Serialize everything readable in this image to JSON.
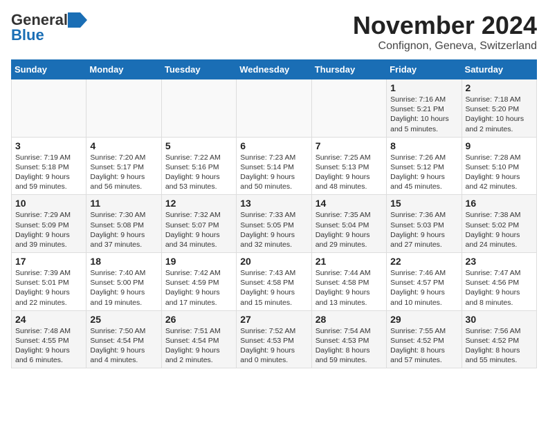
{
  "header": {
    "logo_line1": "General",
    "logo_line2": "Blue",
    "title": "November 2024",
    "subtitle": "Confignon, Geneva, Switzerland"
  },
  "weekdays": [
    "Sunday",
    "Monday",
    "Tuesday",
    "Wednesday",
    "Thursday",
    "Friday",
    "Saturday"
  ],
  "weeks": [
    [
      {
        "day": "",
        "detail": ""
      },
      {
        "day": "",
        "detail": ""
      },
      {
        "day": "",
        "detail": ""
      },
      {
        "day": "",
        "detail": ""
      },
      {
        "day": "",
        "detail": ""
      },
      {
        "day": "1",
        "detail": "Sunrise: 7:16 AM\nSunset: 5:21 PM\nDaylight: 10 hours\nand 5 minutes."
      },
      {
        "day": "2",
        "detail": "Sunrise: 7:18 AM\nSunset: 5:20 PM\nDaylight: 10 hours\nand 2 minutes."
      }
    ],
    [
      {
        "day": "3",
        "detail": "Sunrise: 7:19 AM\nSunset: 5:18 PM\nDaylight: 9 hours\nand 59 minutes."
      },
      {
        "day": "4",
        "detail": "Sunrise: 7:20 AM\nSunset: 5:17 PM\nDaylight: 9 hours\nand 56 minutes."
      },
      {
        "day": "5",
        "detail": "Sunrise: 7:22 AM\nSunset: 5:16 PM\nDaylight: 9 hours\nand 53 minutes."
      },
      {
        "day": "6",
        "detail": "Sunrise: 7:23 AM\nSunset: 5:14 PM\nDaylight: 9 hours\nand 50 minutes."
      },
      {
        "day": "7",
        "detail": "Sunrise: 7:25 AM\nSunset: 5:13 PM\nDaylight: 9 hours\nand 48 minutes."
      },
      {
        "day": "8",
        "detail": "Sunrise: 7:26 AM\nSunset: 5:12 PM\nDaylight: 9 hours\nand 45 minutes."
      },
      {
        "day": "9",
        "detail": "Sunrise: 7:28 AM\nSunset: 5:10 PM\nDaylight: 9 hours\nand 42 minutes."
      }
    ],
    [
      {
        "day": "10",
        "detail": "Sunrise: 7:29 AM\nSunset: 5:09 PM\nDaylight: 9 hours\nand 39 minutes."
      },
      {
        "day": "11",
        "detail": "Sunrise: 7:30 AM\nSunset: 5:08 PM\nDaylight: 9 hours\nand 37 minutes."
      },
      {
        "day": "12",
        "detail": "Sunrise: 7:32 AM\nSunset: 5:07 PM\nDaylight: 9 hours\nand 34 minutes."
      },
      {
        "day": "13",
        "detail": "Sunrise: 7:33 AM\nSunset: 5:05 PM\nDaylight: 9 hours\nand 32 minutes."
      },
      {
        "day": "14",
        "detail": "Sunrise: 7:35 AM\nSunset: 5:04 PM\nDaylight: 9 hours\nand 29 minutes."
      },
      {
        "day": "15",
        "detail": "Sunrise: 7:36 AM\nSunset: 5:03 PM\nDaylight: 9 hours\nand 27 minutes."
      },
      {
        "day": "16",
        "detail": "Sunrise: 7:38 AM\nSunset: 5:02 PM\nDaylight: 9 hours\nand 24 minutes."
      }
    ],
    [
      {
        "day": "17",
        "detail": "Sunrise: 7:39 AM\nSunset: 5:01 PM\nDaylight: 9 hours\nand 22 minutes."
      },
      {
        "day": "18",
        "detail": "Sunrise: 7:40 AM\nSunset: 5:00 PM\nDaylight: 9 hours\nand 19 minutes."
      },
      {
        "day": "19",
        "detail": "Sunrise: 7:42 AM\nSunset: 4:59 PM\nDaylight: 9 hours\nand 17 minutes."
      },
      {
        "day": "20",
        "detail": "Sunrise: 7:43 AM\nSunset: 4:58 PM\nDaylight: 9 hours\nand 15 minutes."
      },
      {
        "day": "21",
        "detail": "Sunrise: 7:44 AM\nSunset: 4:58 PM\nDaylight: 9 hours\nand 13 minutes."
      },
      {
        "day": "22",
        "detail": "Sunrise: 7:46 AM\nSunset: 4:57 PM\nDaylight: 9 hours\nand 10 minutes."
      },
      {
        "day": "23",
        "detail": "Sunrise: 7:47 AM\nSunset: 4:56 PM\nDaylight: 9 hours\nand 8 minutes."
      }
    ],
    [
      {
        "day": "24",
        "detail": "Sunrise: 7:48 AM\nSunset: 4:55 PM\nDaylight: 9 hours\nand 6 minutes."
      },
      {
        "day": "25",
        "detail": "Sunrise: 7:50 AM\nSunset: 4:54 PM\nDaylight: 9 hours\nand 4 minutes."
      },
      {
        "day": "26",
        "detail": "Sunrise: 7:51 AM\nSunset: 4:54 PM\nDaylight: 9 hours\nand 2 minutes."
      },
      {
        "day": "27",
        "detail": "Sunrise: 7:52 AM\nSunset: 4:53 PM\nDaylight: 9 hours\nand 0 minutes."
      },
      {
        "day": "28",
        "detail": "Sunrise: 7:54 AM\nSunset: 4:53 PM\nDaylight: 8 hours\nand 59 minutes."
      },
      {
        "day": "29",
        "detail": "Sunrise: 7:55 AM\nSunset: 4:52 PM\nDaylight: 8 hours\nand 57 minutes."
      },
      {
        "day": "30",
        "detail": "Sunrise: 7:56 AM\nSunset: 4:52 PM\nDaylight: 8 hours\nand 55 minutes."
      }
    ]
  ]
}
